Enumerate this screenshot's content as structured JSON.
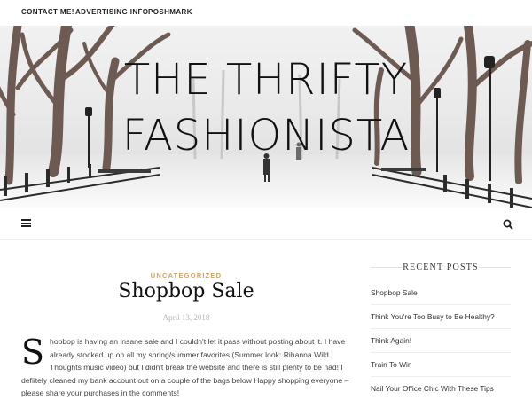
{
  "topnav": {
    "items": [
      "CONTACT ME!",
      "ADVERTISING INFO",
      "POSHMARK"
    ]
  },
  "header": {
    "title_line1": "THE THRIFTY",
    "title_line2": "FASHIONISTA"
  },
  "menubar": {
    "menu_icon": "hamburger-icon",
    "search_icon": "search-icon"
  },
  "post": {
    "category": "UNCATEGORIZED",
    "title": "Shopbop Sale",
    "date": "April 13, 2018",
    "dropcap": "S",
    "body": "hopbop is having an insane sale and I couldn't let it pass without posting about it. I have already stocked up on all my spring/summer favorites (Summer look: Rihanna Wild Thoughts music video) but I didn't break the website and there is still plenty to be had! I defiitely cleaned my bank account out on a couple of the bags below Happy shopping everyone – please share your purchases in the comments!"
  },
  "sidebar": {
    "title": "RECENT POSTS",
    "items": [
      "Shopbop Sale",
      "Think You're Too Busy to Be Healthy?",
      "Think Again!",
      "Train To Win",
      "Nail Your Office Chic With These Tips"
    ]
  },
  "colors": {
    "category": "#c9a467",
    "date": "#b4b4b4",
    "text": "#444444"
  }
}
